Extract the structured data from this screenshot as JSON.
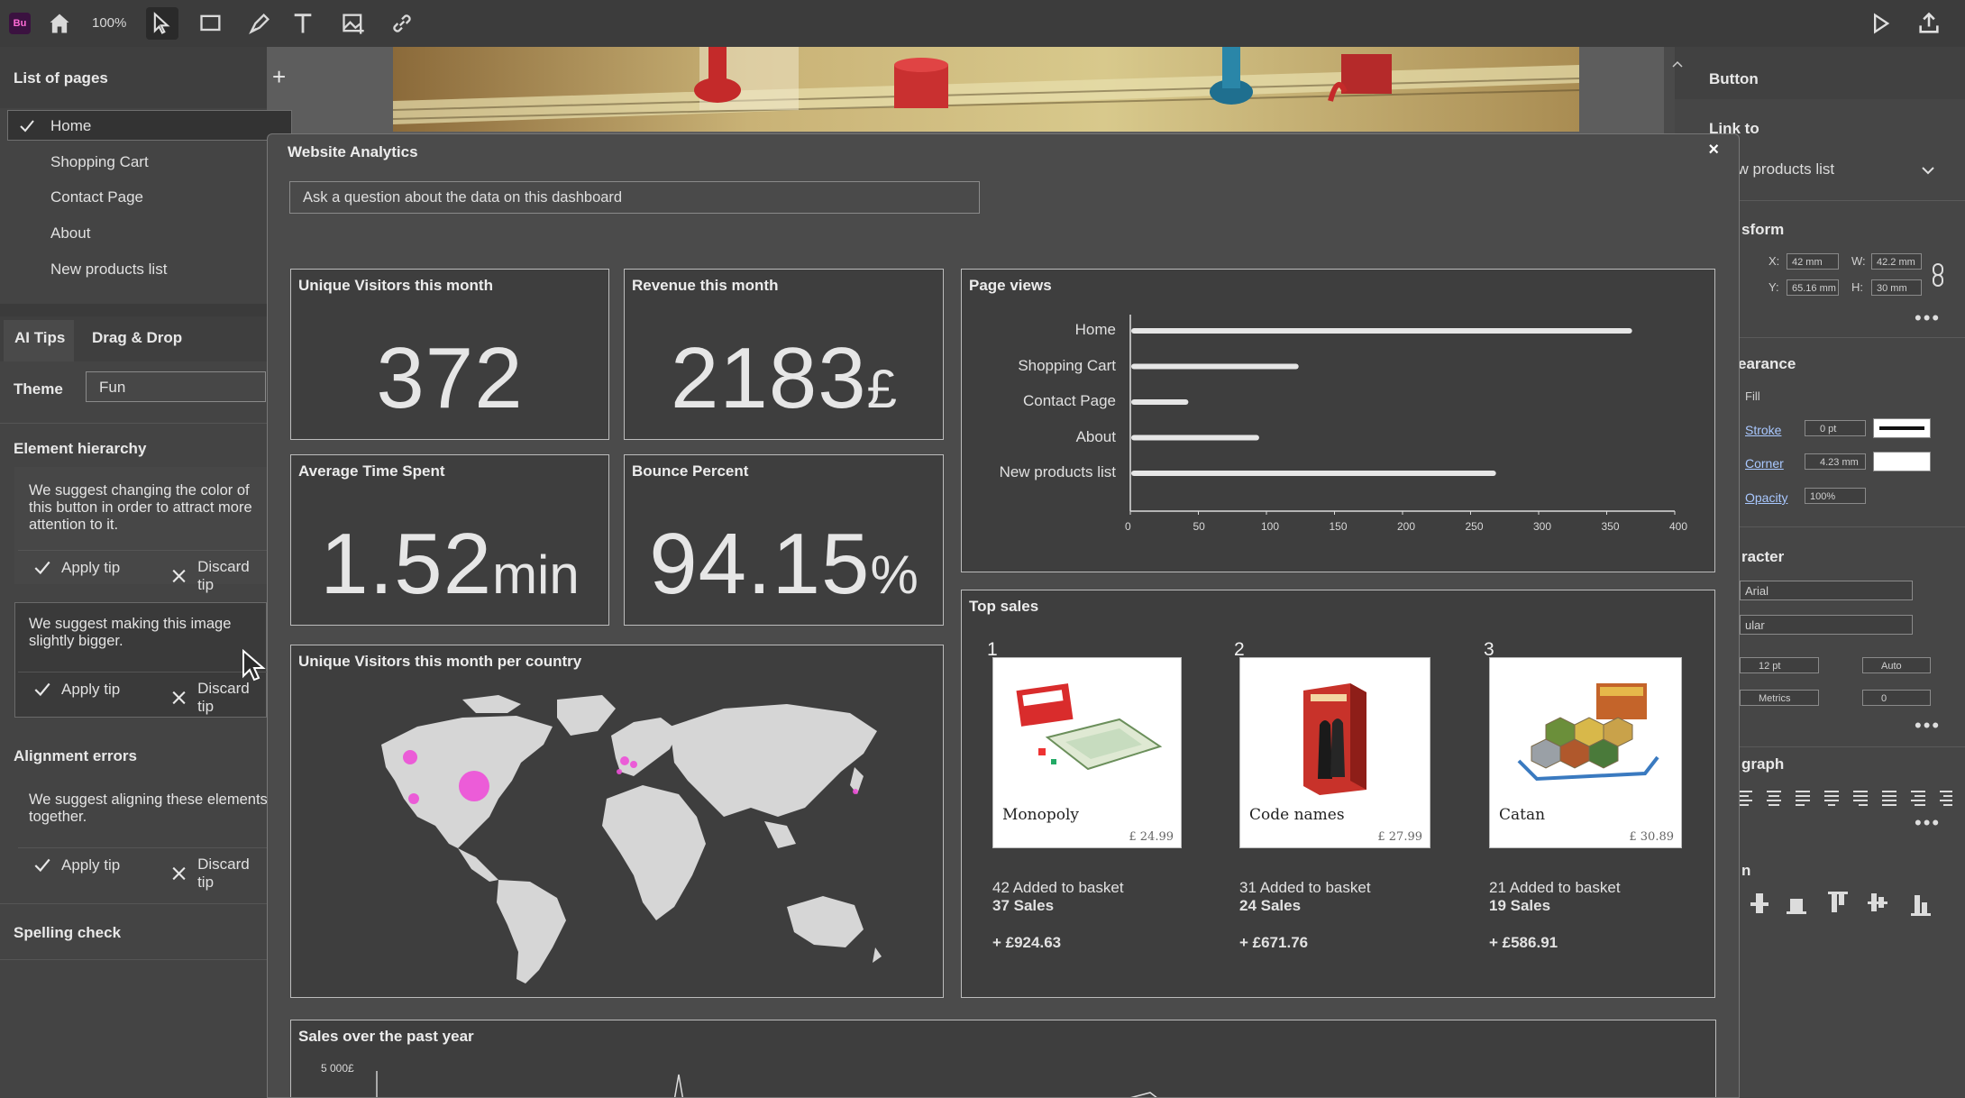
{
  "app": {
    "logo_text": "Bu",
    "zoom": "100%"
  },
  "toolbar": {
    "icons": [
      "home-icon",
      "select-icon",
      "rectangle-icon",
      "pen-icon",
      "text-icon",
      "image-icon",
      "link-icon",
      "play-icon",
      "export-icon"
    ]
  },
  "left_panel": {
    "pages_title": "List of pages",
    "add_symbol": "+",
    "pages": [
      "Home",
      "Shopping Cart",
      "Contact Page",
      "About",
      "New products list"
    ],
    "selected_page": "Home",
    "tabs": [
      "AI Tips",
      "Drag & Drop"
    ],
    "theme_label": "Theme",
    "theme_value": "Fun",
    "element_hierarchy_title": "Element hierarchy",
    "tip1": "We suggest changing the color of this button in order to attract more attention to it.",
    "tip2": "We suggest making this image slightly bigger.",
    "alignment_title": "Alignment errors",
    "tip3": "We suggest aligning these elements together.",
    "apply_label": "Apply tip",
    "discard_label": "Discard tip",
    "spelling_title": "Spelling check"
  },
  "right_panel": {
    "title": "Button",
    "link_to_label": "Link to",
    "link_to_value": "ew products list",
    "transform_title": "sform",
    "x_label": "X:",
    "x_value": "42 mm",
    "w_label": "W:",
    "w_value": "42.2 mm",
    "y_label": "Y:",
    "y_value": "65.16 mm",
    "h_label": "H:",
    "h_value": "30 mm",
    "appearance_title": "earance",
    "fill_label": "Fill",
    "stroke_label": "Stroke",
    "stroke_value": "0 pt",
    "corner_label": "Corner",
    "corner_value": "4.23 mm",
    "opacity_label": "Opacity",
    "opacity_value": "100%",
    "character_title": "racter",
    "font_value": "Arial",
    "style_value": "ular",
    "size_value": "12 pt",
    "leading_value": "Auto",
    "kerning_value": "Metrics",
    "tracking_value": "0",
    "paragraph_title": "graph",
    "align_title": "n",
    "more": "•••"
  },
  "modal": {
    "title": "Website Analytics",
    "close": "×",
    "question_placeholder": "Ask a question about the data on this dashboard",
    "visitors_title": "Unique Visitors this month",
    "visitors_value": "372",
    "revenue_title": "Revenue this month",
    "revenue_value": "2183",
    "revenue_unit": "£",
    "time_title": "Average Time Spent",
    "time_value": "1.52",
    "time_unit": "min",
    "bounce_title": "Bounce Percent",
    "bounce_value": "94.15",
    "bounce_unit": "%",
    "map_title": "Unique Visitors this month per country",
    "page_views_title": "Page views",
    "top_sales_title": "Top sales",
    "sales_year_title": "Sales over the past year",
    "sales_year_tick": "5 000£",
    "products": [
      {
        "rank": "1",
        "name": "Monopoly",
        "price": "£ 24.99",
        "added": "42 Added to basket",
        "sales": "37 Sales",
        "revenue": "+ £924.63"
      },
      {
        "rank": "2",
        "name": "Code names",
        "price": "£ 27.99",
        "added": "31 Added to basket",
        "sales": "24 Sales",
        "revenue": "+ £671.76"
      },
      {
        "rank": "3",
        "name": "Catan",
        "price": "£ 30.89",
        "added": "21 Added to basket",
        "sales": "19 Sales",
        "revenue": "+ £586.91"
      }
    ]
  },
  "chart_data": {
    "type": "bar",
    "orientation": "horizontal",
    "categories": [
      "Home",
      "Shopping Cart",
      "Contact Page",
      "About",
      "New products list"
    ],
    "values": [
      368,
      123,
      42,
      94,
      268
    ],
    "xlim": [
      0,
      400
    ],
    "x_ticks": [
      "0",
      "50",
      "100",
      "150",
      "200",
      "250",
      "300",
      "350",
      "400"
    ],
    "title": "Page views",
    "color": "#e6e6e6"
  }
}
